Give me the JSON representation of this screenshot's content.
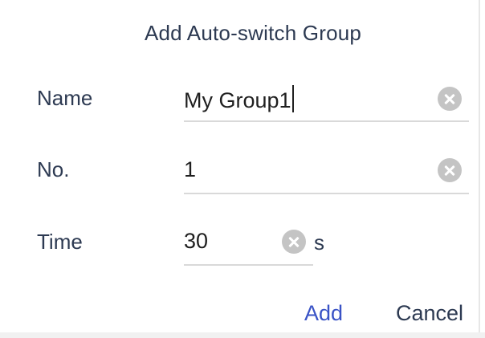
{
  "dialog": {
    "title": "Add Auto-switch Group",
    "fields": {
      "name": {
        "label": "Name",
        "value": "My Group1"
      },
      "number": {
        "label": "No.",
        "value": "1"
      },
      "time": {
        "label": "Time",
        "value": "30",
        "unit": "s"
      }
    },
    "buttons": {
      "add": "Add",
      "cancel": "Cancel"
    }
  },
  "colors": {
    "text": "#2d3a52",
    "accent": "#3a53c6",
    "clear_icon": "#c4c4c4",
    "underline": "#d9d9d9"
  },
  "icons": [
    "clear-icon"
  ]
}
